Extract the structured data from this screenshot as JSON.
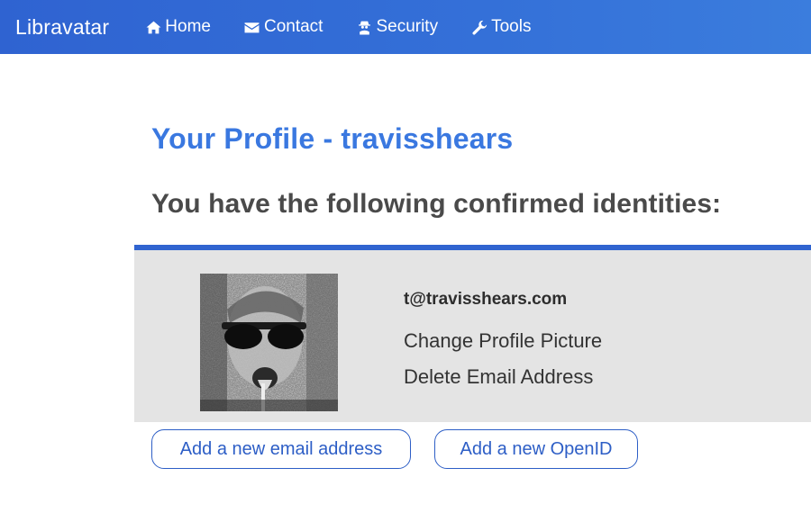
{
  "navbar": {
    "brand": "Libravatar",
    "items": [
      {
        "label": "Home",
        "icon": "home-icon"
      },
      {
        "label": "Contact",
        "icon": "envelope-icon"
      },
      {
        "label": "Security",
        "icon": "user-secret-icon"
      },
      {
        "label": "Tools",
        "icon": "wrench-icon"
      }
    ],
    "background_color": "#3470d8"
  },
  "main": {
    "title": "Your Profile - travisshears",
    "subtitle": "You have the following confirmed identities:"
  },
  "identity": {
    "email": "t@travisshears.com",
    "change_picture_label": "Change Profile Picture",
    "delete_email_label": "Delete Email Address",
    "accent_color": "#3064d0"
  },
  "actions": {
    "add_email_label": "Add a new email address",
    "add_openid_label": "Add a new OpenID"
  }
}
